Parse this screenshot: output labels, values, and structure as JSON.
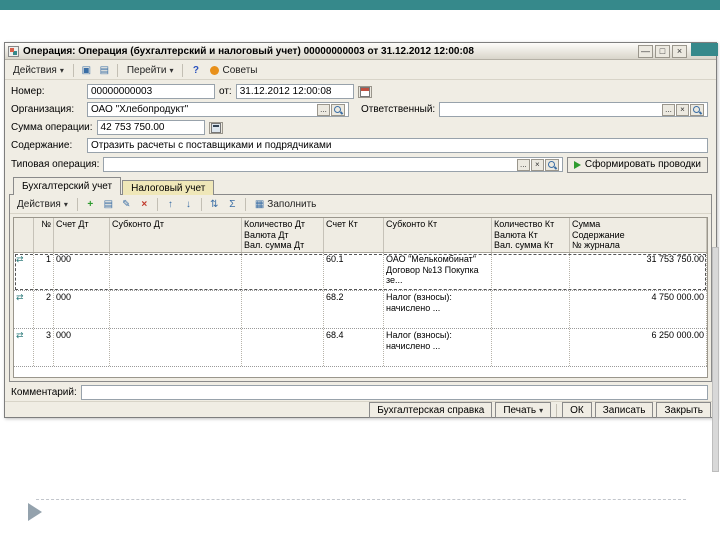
{
  "icons": {
    "dropdown": "▾",
    "ellipsis": "...",
    "clear": "×",
    "minimize": "—",
    "maximize": "□",
    "close": "×",
    "add": "+",
    "copy": "▤",
    "edit": "✎",
    "delete": "×",
    "up": "↑",
    "down": "↓",
    "reorder": "⇅",
    "totals": "Σ",
    "fill": "▦",
    "save": "▣",
    "help": "?",
    "posting": "⇄"
  },
  "window": {
    "title": "Операция: Операция (бухгалтерский и налоговый учет) 00000000003 от 31.12.2012 12:00:08",
    "main_toolbar": {
      "actions": "Действия",
      "goto": "Перейти",
      "tips": "Советы"
    },
    "form": {
      "number": {
        "label": "Номер:",
        "value": "00000000003"
      },
      "date": {
        "label": "от:",
        "value": "31.12.2012 12:00:08"
      },
      "organization": {
        "label": "Организация:",
        "value": "ОАО \"Хлебопродукт\""
      },
      "responsible": {
        "label": "Ответственный:",
        "value": ""
      },
      "amount": {
        "label": "Сумма операции:",
        "value": "42 753 750.00"
      },
      "content": {
        "label": "Содержание:",
        "value": "Отразить расчеты с поставщиками и подрядчиками"
      },
      "typical": {
        "label": "Типовая операция:",
        "value": ""
      },
      "generate": "Сформировать проводки"
    },
    "tabs": {
      "accounting": "Бухгалтерский учет",
      "tax": "Налоговый учет"
    },
    "grid_toolbar": {
      "actions": "Действия",
      "fill": "Заполнить"
    },
    "grid": {
      "headers": {
        "num": "№",
        "debit_account": "Счет Дт",
        "debit_subconto": "Субконто Дт",
        "debit_qty1": "Количество Дт",
        "debit_qty2": "Валюта Дт",
        "debit_qty3": "Вал. сумма Дт",
        "credit_account": "Счет Кт",
        "credit_subconto": "Субконто Кт",
        "credit_qty1": "Количество Кт",
        "credit_qty2": "Валюта Кт",
        "credit_qty3": "Вал. сумма Кт",
        "sum1": "Сумма",
        "sum2": "Содержание",
        "sum3": "№ журнала"
      },
      "rows": [
        {
          "num": "1",
          "dt": "000",
          "kt": "60.1",
          "kt_sub1": "ОАО \"Мелькомбинат\"",
          "kt_sub2": "Договор №13 Покупка зе...",
          "sum": "31 753 750.00"
        },
        {
          "num": "2",
          "dt": "000",
          "kt": "68.2",
          "kt_sub1": "Налог (взносы): начислено ...",
          "kt_sub2": "",
          "sum": "4 750 000.00"
        },
        {
          "num": "3",
          "dt": "000",
          "kt": "68.4",
          "kt_sub1": "Налог (взносы): начислено ...",
          "kt_sub2": "",
          "sum": "6 250 000.00"
        }
      ]
    },
    "comment": {
      "label": "Комментарий:",
      "value": ""
    },
    "footer": {
      "reference": "Бухгалтерская справка",
      "print": "Печать",
      "ok": "ОК",
      "save": "Записать",
      "close": "Закрыть"
    }
  }
}
